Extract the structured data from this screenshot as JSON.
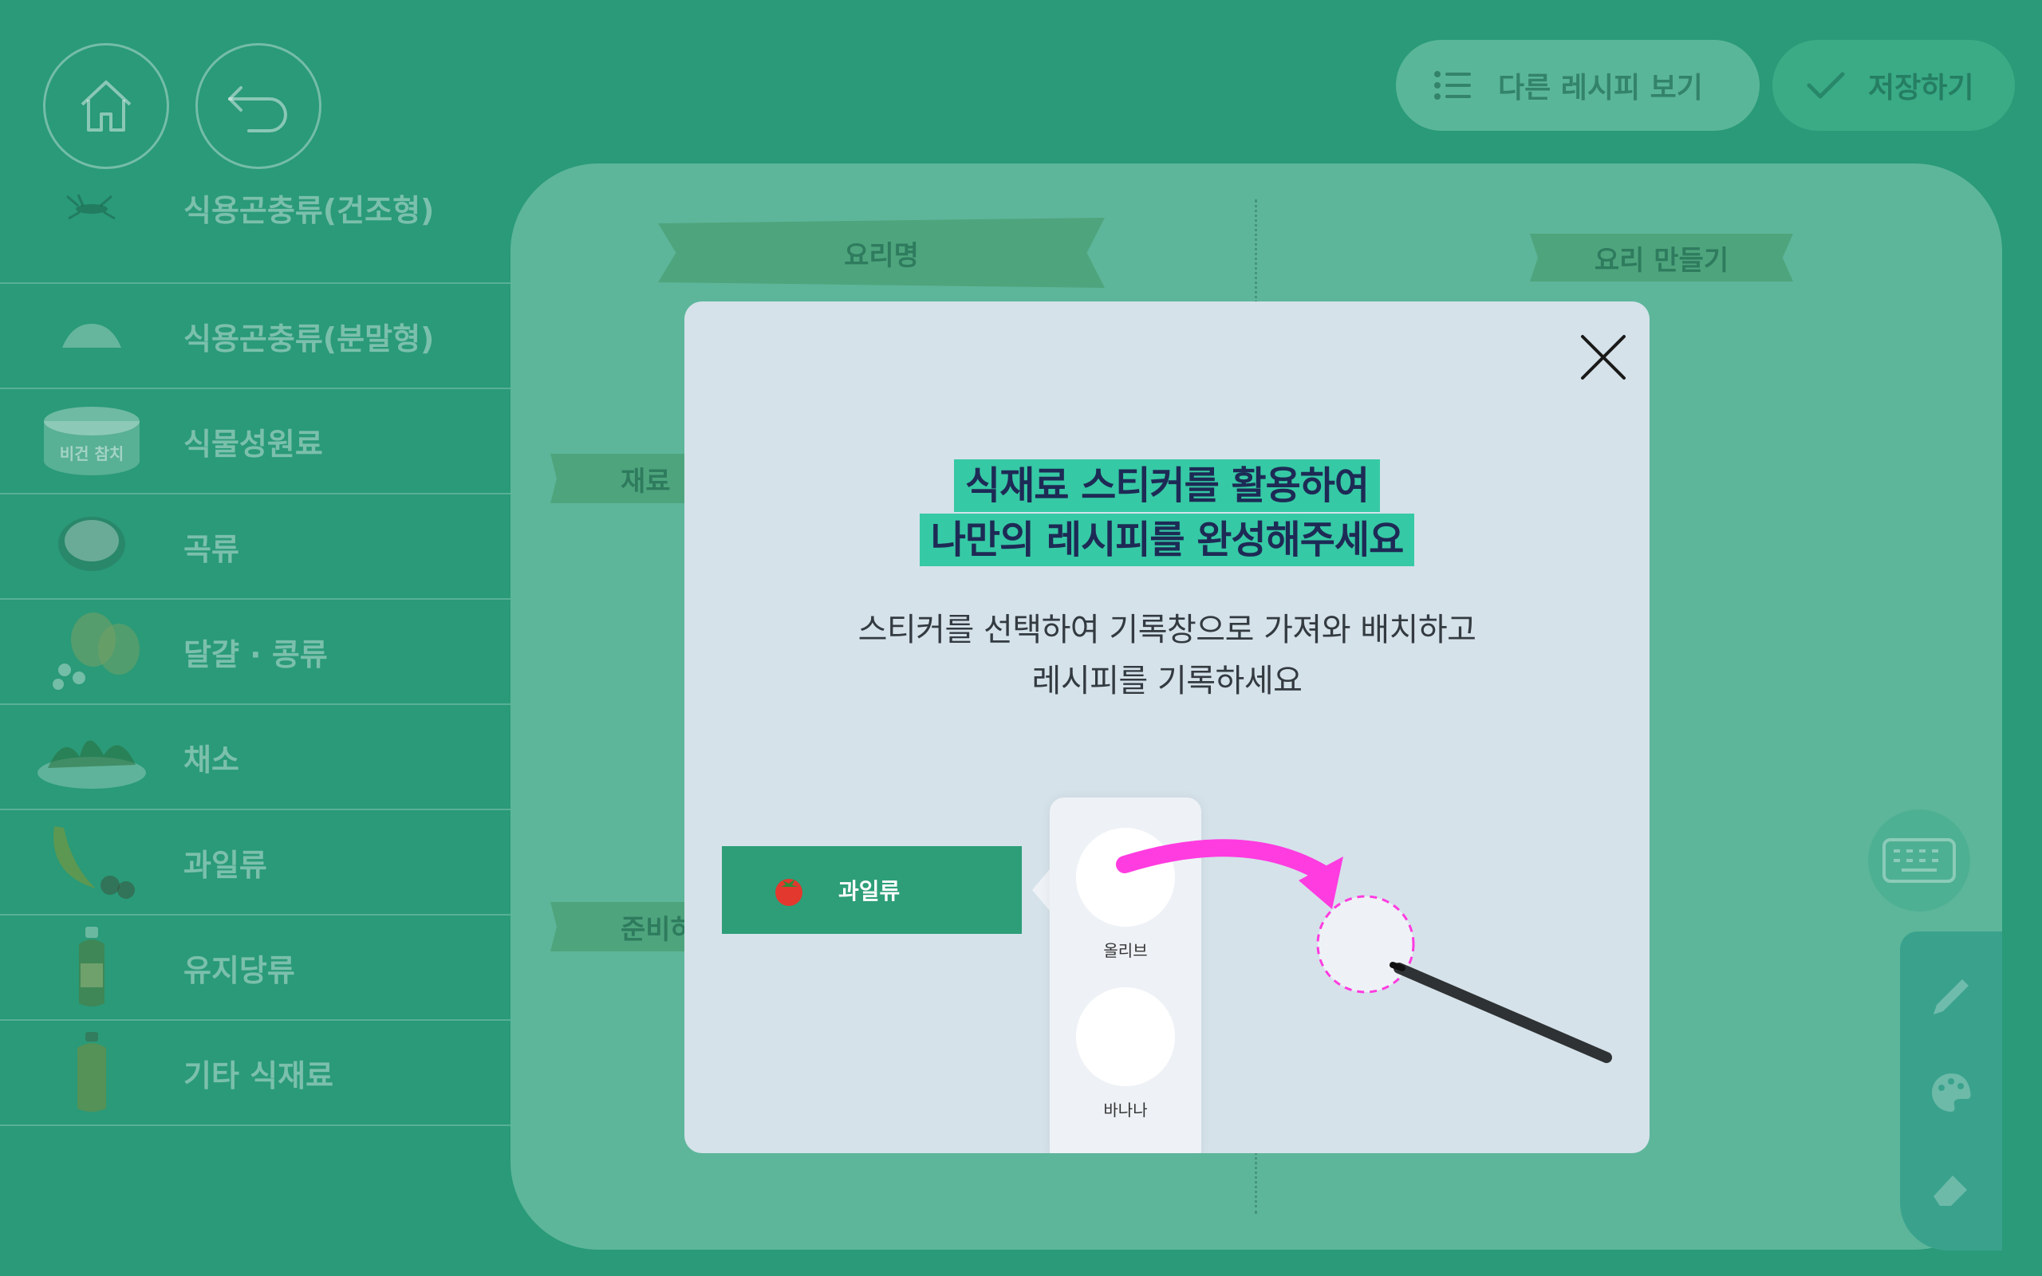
{
  "nav": {
    "home_icon": "home-icon",
    "back_icon": "back-arrow-icon",
    "other_recipes_label": "다른 레시피 보기",
    "save_label": "저장하기"
  },
  "sidebar": {
    "items": [
      {
        "label": "식용곤충류(건조형)",
        "icon": "dried-insect-icon"
      },
      {
        "label": "식용곤충류(분말형)",
        "icon": "insect-powder-icon"
      },
      {
        "label": "식물성원료",
        "icon": "plant-based-can-icon",
        "can_text": "비건 참치"
      },
      {
        "label": "곡류",
        "icon": "grain-bowl-icon"
      },
      {
        "label": "달걀 · 콩류",
        "icon": "egg-bean-icon"
      },
      {
        "label": "채소",
        "icon": "vegetable-icon"
      },
      {
        "label": "과일류",
        "icon": "fruit-icon"
      },
      {
        "label": "유지당류",
        "icon": "oil-sugar-icon"
      },
      {
        "label": "기타 식재료",
        "icon": "other-ingredient-icon"
      }
    ]
  },
  "canvas": {
    "dish_name_label": "요리명",
    "cooking_label": "요리 만들기",
    "ingredients_label": "재료",
    "prep_label": "준비하기"
  },
  "modal": {
    "headline_line1": "식재료 스티커를 활용하여",
    "headline_line2": "나만의 레시피를 완성해주세요",
    "subtext_line1": "스티커를 선택하여 기록창으로 가져와 배치하고",
    "subtext_line2": "레시피를 기록하세요",
    "demo_category_label": "과일류",
    "demo_items": [
      "올리브",
      "바나나"
    ]
  },
  "colors": {
    "background": "#2a9a78",
    "canvas": "#5db69a",
    "headline_highlight": "#36c9a5",
    "headline_text": "#1d2a55",
    "arrow": "#ff3ce0"
  }
}
